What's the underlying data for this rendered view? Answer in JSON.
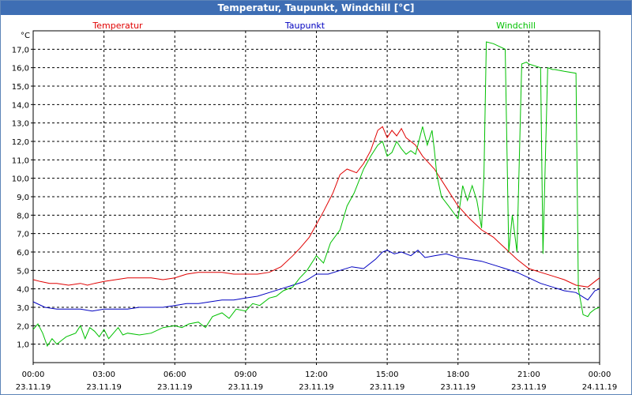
{
  "window": {
    "title": "Temperatur, Taupunkt, Windchill [°C]"
  },
  "colors": {
    "temperatur": "#e00000",
    "taupunkt": "#0000c0",
    "windchill": "#00c000",
    "grid": "#000000",
    "title_bar": "#3e6eb4"
  },
  "chart_data": {
    "type": "line",
    "title": "Temperatur, Taupunkt, Windchill [°C]",
    "ylabel": "°C",
    "ylim": [
      0,
      18
    ],
    "grid": true,
    "legend": "top",
    "y_ticks": [
      "1,0",
      "2,0",
      "3,0",
      "4,0",
      "5,0",
      "6,0",
      "7,0",
      "8,0",
      "9,0",
      "10,0",
      "11,0",
      "12,0",
      "13,0",
      "14,0",
      "15,0",
      "16,0",
      "17,0"
    ],
    "x_ticks": [
      {
        "time": "00:00",
        "date": "23.11.19"
      },
      {
        "time": "03:00",
        "date": "23.11.19"
      },
      {
        "time": "06:00",
        "date": "23.11.19"
      },
      {
        "time": "09:00",
        "date": "23.11.19"
      },
      {
        "time": "12:00",
        "date": "23.11.19"
      },
      {
        "time": "15:00",
        "date": "23.11.19"
      },
      {
        "time": "18:00",
        "date": "23.11.19"
      },
      {
        "time": "21:00",
        "date": "23.11.19"
      },
      {
        "time": "00:00",
        "date": "24.11.19"
      }
    ],
    "x_unit": "hours",
    "xlim": [
      0,
      24
    ],
    "series": [
      {
        "name": "Temperatur",
        "color": "#e00000",
        "x": [
          0,
          0.3,
          0.7,
          1,
          1.5,
          2,
          2.3,
          2.6,
          3,
          3.5,
          4,
          4.5,
          5,
          5.5,
          6,
          6.5,
          7,
          7.5,
          8,
          8.5,
          9,
          9.5,
          10,
          10.5,
          11,
          11.3,
          11.7,
          12,
          12.3,
          12.7,
          13,
          13.3,
          13.7,
          14,
          14.3,
          14.6,
          14.8,
          15,
          15.2,
          15.4,
          15.6,
          15.8,
          16,
          16.2,
          16.5,
          17,
          17.5,
          18,
          18.5,
          19,
          19.5,
          20,
          20.5,
          21,
          21.5,
          22,
          22.5,
          23,
          23.5,
          23.8,
          24
        ],
        "y": [
          4.5,
          4.4,
          4.3,
          4.3,
          4.2,
          4.3,
          4.2,
          4.3,
          4.4,
          4.5,
          4.6,
          4.6,
          4.6,
          4.5,
          4.6,
          4.8,
          4.9,
          4.9,
          4.9,
          4.8,
          4.8,
          4.8,
          4.9,
          5.2,
          5.8,
          6.2,
          6.8,
          7.5,
          8.2,
          9.2,
          10.2,
          10.5,
          10.3,
          10.8,
          11.5,
          12.6,
          12.8,
          12.2,
          12.6,
          12.3,
          12.7,
          12.2,
          12.0,
          11.8,
          11.2,
          10.5,
          9.5,
          8.5,
          7.8,
          7.2,
          6.8,
          6.2,
          5.6,
          5.1,
          4.9,
          4.7,
          4.5,
          4.2,
          4.1,
          4.4,
          4.6
        ]
      },
      {
        "name": "Taupunkt",
        "color": "#0000c0",
        "x": [
          0,
          0.5,
          1,
          1.5,
          2,
          2.5,
          3,
          3.5,
          4,
          4.5,
          5,
          5.5,
          6,
          6.5,
          7,
          7.5,
          8,
          8.5,
          9,
          9.5,
          10,
          10.5,
          11,
          11.5,
          12,
          12.5,
          13,
          13.5,
          14,
          14.5,
          14.8,
          15,
          15.3,
          15.6,
          16,
          16.3,
          16.6,
          17,
          17.5,
          18,
          18.5,
          19,
          19.5,
          20,
          20.5,
          21,
          21.5,
          22,
          22.5,
          23,
          23.5,
          23.8,
          24
        ],
        "y": [
          3.3,
          3.0,
          2.9,
          2.9,
          2.9,
          2.8,
          2.9,
          2.9,
          2.9,
          3.0,
          3.0,
          3.0,
          3.1,
          3.2,
          3.2,
          3.3,
          3.4,
          3.4,
          3.5,
          3.6,
          3.8,
          4.0,
          4.2,
          4.4,
          4.8,
          4.8,
          5.0,
          5.2,
          5.1,
          5.6,
          6.0,
          6.1,
          5.9,
          6.0,
          5.8,
          6.1,
          5.7,
          5.8,
          5.9,
          5.7,
          5.6,
          5.5,
          5.3,
          5.1,
          4.9,
          4.6,
          4.3,
          4.1,
          3.9,
          3.8,
          3.4,
          3.9,
          4.0
        ]
      },
      {
        "name": "Windchill",
        "color": "#00c000",
        "x": [
          0,
          0.2,
          0.4,
          0.6,
          0.8,
          1.0,
          1.2,
          1.4,
          1.6,
          1.8,
          2.0,
          2.2,
          2.4,
          2.6,
          2.8,
          3.0,
          3.2,
          3.4,
          3.6,
          3.8,
          4,
          4.5,
          5,
          5.5,
          6,
          6.3,
          6.6,
          7,
          7.3,
          7.6,
          8,
          8.3,
          8.6,
          9,
          9.3,
          9.6,
          10,
          10.3,
          10.6,
          11,
          11.3,
          11.6,
          12,
          12.3,
          12.6,
          13,
          13.3,
          13.6,
          14,
          14.3,
          14.6,
          14.8,
          15,
          15.2,
          15.4,
          15.6,
          15.8,
          16,
          16.2,
          16.5,
          16.7,
          16.9,
          17.0,
          17.1,
          17.3,
          17.6,
          18,
          18.2,
          18.4,
          18.6,
          18.8,
          19,
          19.1,
          19.2,
          19.5,
          20,
          20.15,
          20.3,
          20.5,
          20.7,
          20.9,
          21,
          21.5,
          21.6,
          21.8,
          22,
          22.1,
          22.5,
          23,
          23.1,
          23.3,
          23.5,
          23.6,
          23.8,
          24
        ],
        "y": [
          1.8,
          2.1,
          1.6,
          0.9,
          1.3,
          1.0,
          1.2,
          1.4,
          1.5,
          1.6,
          2.0,
          1.3,
          1.9,
          1.7,
          1.4,
          1.8,
          1.3,
          1.6,
          1.9,
          1.5,
          1.6,
          1.5,
          1.6,
          1.9,
          2.0,
          1.9,
          2.1,
          2.2,
          1.9,
          2.5,
          2.7,
          2.4,
          2.9,
          2.8,
          3.2,
          3.1,
          3.5,
          3.6,
          3.9,
          4.1,
          4.6,
          5.0,
          5.8,
          5.4,
          6.5,
          7.2,
          8.5,
          9.2,
          10.5,
          11.2,
          11.8,
          12.0,
          11.2,
          11.4,
          12.0,
          11.6,
          11.3,
          11.5,
          11.3,
          12.8,
          11.8,
          12.6,
          11.5,
          10.2,
          9.0,
          8.5,
          7.8,
          9.6,
          8.8,
          9.6,
          8.8,
          7.3,
          10.2,
          17.4,
          17.3,
          17.0,
          6.0,
          8.0,
          6.0,
          16.2,
          16.3,
          16.2,
          16.0,
          5.9,
          16.0,
          15.9,
          15.9,
          15.8,
          15.7,
          4.0,
          2.6,
          2.5,
          2.7,
          2.9,
          3.0
        ]
      }
    ]
  }
}
